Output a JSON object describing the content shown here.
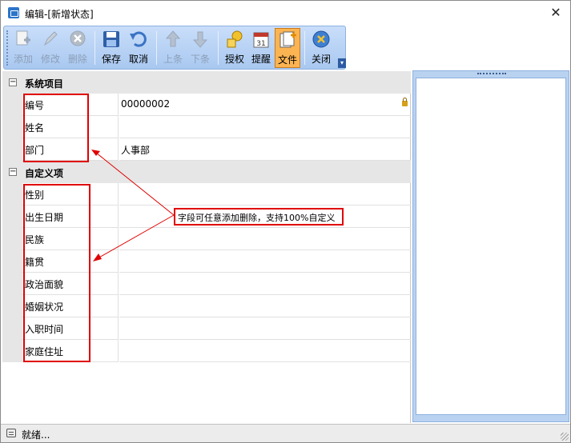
{
  "window": {
    "title": "编辑-[新增状态]"
  },
  "toolbar": {
    "buttons": [
      {
        "label": "添加",
        "icon": "add-icon",
        "enabled": false
      },
      {
        "label": "修改",
        "icon": "edit-icon",
        "enabled": false
      },
      {
        "label": "删除",
        "icon": "delete-icon",
        "enabled": false
      },
      {
        "label": "保存",
        "icon": "save-icon",
        "enabled": true
      },
      {
        "label": "取消",
        "icon": "undo-icon",
        "enabled": true
      },
      {
        "label": "上条",
        "icon": "up-arrow-icon",
        "enabled": false
      },
      {
        "label": "下条",
        "icon": "down-arrow-icon",
        "enabled": false
      },
      {
        "label": "授权",
        "icon": "key-icon",
        "enabled": true
      },
      {
        "label": "提醒",
        "icon": "calendar-icon",
        "enabled": true
      },
      {
        "label": "文件",
        "icon": "file-icon",
        "enabled": true,
        "active": true
      },
      {
        "label": "关闭",
        "icon": "close-app-icon",
        "enabled": true
      }
    ]
  },
  "grid": {
    "categories": [
      {
        "label": "系统项目",
        "toggle": "⊟",
        "rows": [
          {
            "name": "编号",
            "value": "00000002",
            "locked": true
          },
          {
            "name": "姓名",
            "value": ""
          },
          {
            "name": "部门",
            "value": "人事部"
          }
        ]
      },
      {
        "label": "自定义项",
        "toggle": "⊟",
        "rows": [
          {
            "name": "性别",
            "value": ""
          },
          {
            "name": "出生日期",
            "value": ""
          },
          {
            "name": "民族",
            "value": ""
          },
          {
            "name": "籍贯",
            "value": ""
          },
          {
            "name": "政治面貌",
            "value": ""
          },
          {
            "name": "婚姻状况",
            "value": ""
          },
          {
            "name": "入职时间",
            "value": ""
          },
          {
            "name": "家庭住址",
            "value": ""
          }
        ]
      }
    ]
  },
  "annotation": {
    "text": "字段可任意添加删除，支持100%自定义",
    "color": "#e00000"
  },
  "status": {
    "text": "就绪..."
  }
}
